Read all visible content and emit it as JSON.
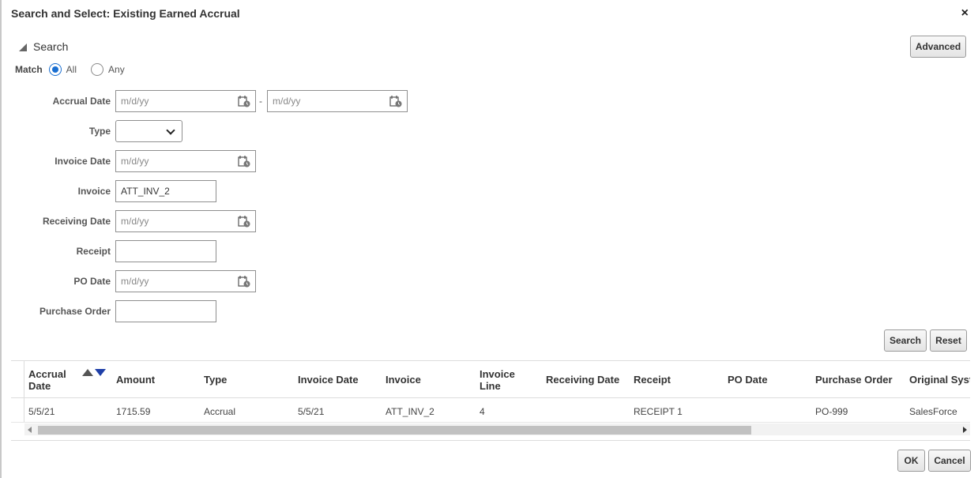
{
  "dialog": {
    "title": "Search and Select: Existing Earned Accrual",
    "close_icon": "×"
  },
  "search": {
    "toggle_label": "Search",
    "advanced_label": "Advanced",
    "match_label": "Match",
    "match_options": [
      "All",
      "Any"
    ],
    "match_selected": "All",
    "date_separator": "-",
    "fields": {
      "accrual_date": {
        "label": "Accrual Date",
        "from_placeholder": "m/d/yy",
        "to_placeholder": "m/d/yy"
      },
      "type": {
        "label": "Type",
        "value": ""
      },
      "invoice_date": {
        "label": "Invoice Date",
        "placeholder": "m/d/yy"
      },
      "invoice": {
        "label": "Invoice",
        "value": "ATT_INV_2"
      },
      "receiving_date": {
        "label": "Receiving Date",
        "placeholder": "m/d/yy"
      },
      "receipt": {
        "label": "Receipt",
        "value": ""
      },
      "po_date": {
        "label": "PO Date",
        "placeholder": "m/d/yy"
      },
      "purchase_order": {
        "label": "Purchase Order",
        "value": ""
      }
    },
    "search_button": "Search",
    "reset_button": "Reset"
  },
  "table": {
    "columns": [
      {
        "line1": "Accrual",
        "line2": "Date"
      },
      {
        "line1": "Amount",
        "line2": ""
      },
      {
        "line1": "Type",
        "line2": ""
      },
      {
        "line1": "Invoice Date",
        "line2": ""
      },
      {
        "line1": "Invoice",
        "line2": ""
      },
      {
        "line1": "Invoice",
        "line2": "Line"
      },
      {
        "line1": "Receiving Date",
        "line2": ""
      },
      {
        "line1": "Receipt",
        "line2": ""
      },
      {
        "line1": "PO Date",
        "line2": ""
      },
      {
        "line1": "Purchase Order",
        "line2": ""
      },
      {
        "line1": "Original Syst",
        "line2": ""
      }
    ],
    "rows": [
      [
        "5/5/21",
        "1715.59",
        "Accrual",
        "5/5/21",
        "ATT_INV_2",
        "4",
        "",
        "RECEIPT 1",
        "",
        "PO-999",
        "SalesForce"
      ]
    ]
  },
  "footer": {
    "ok_label": "OK",
    "cancel_label": "Cancel"
  },
  "colors": {
    "accent": "#1a6fd1",
    "sort_desc": "#1f3fa8"
  }
}
